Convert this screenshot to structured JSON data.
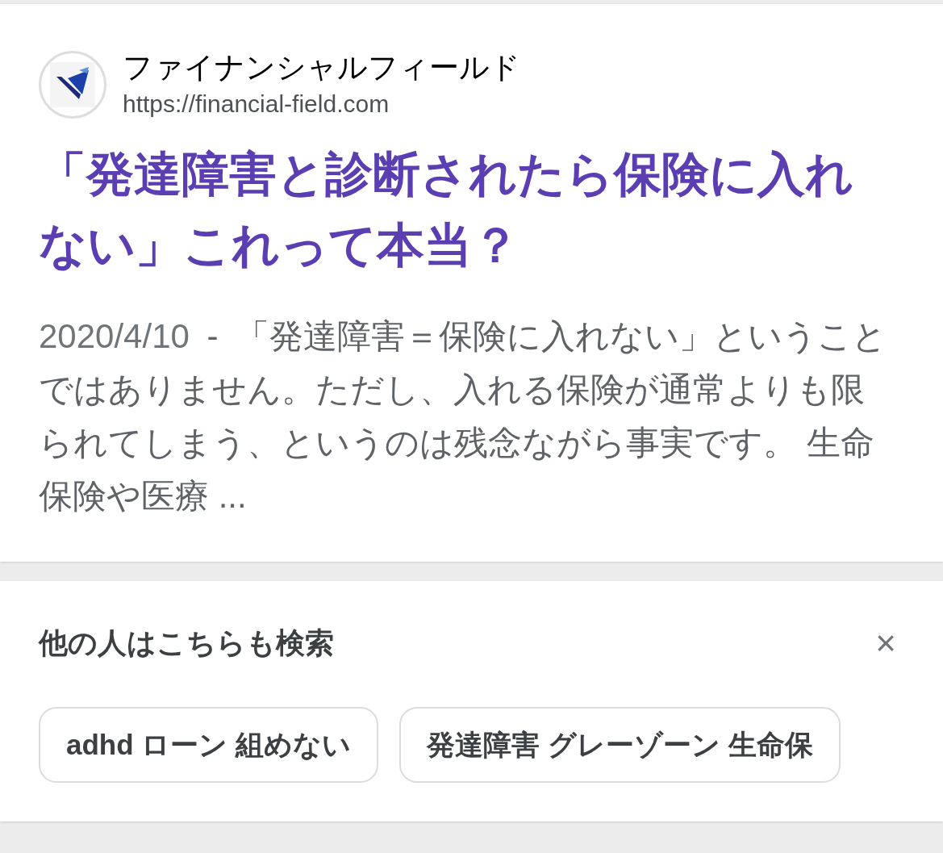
{
  "result": {
    "site_name": "ファイナンシャルフィールド",
    "url": "https://financial-field.com",
    "title": "「発達障害と診断されたら保険に入れない」これって本当？",
    "date": "2020/4/10",
    "separator": "-",
    "snippet": "「発達障害＝保険に入れない」ということではありません。ただし、入れる保険が通常よりも限られてしまう、というのは残念ながら事実です。 生命保険や医療 ..."
  },
  "related": {
    "heading": "他の人はこちらも検索",
    "close": "×",
    "chips": [
      {
        "label": "adhd ローン 組めない"
      },
      {
        "label": "発達障害 グレーゾーン 生命保"
      }
    ]
  }
}
